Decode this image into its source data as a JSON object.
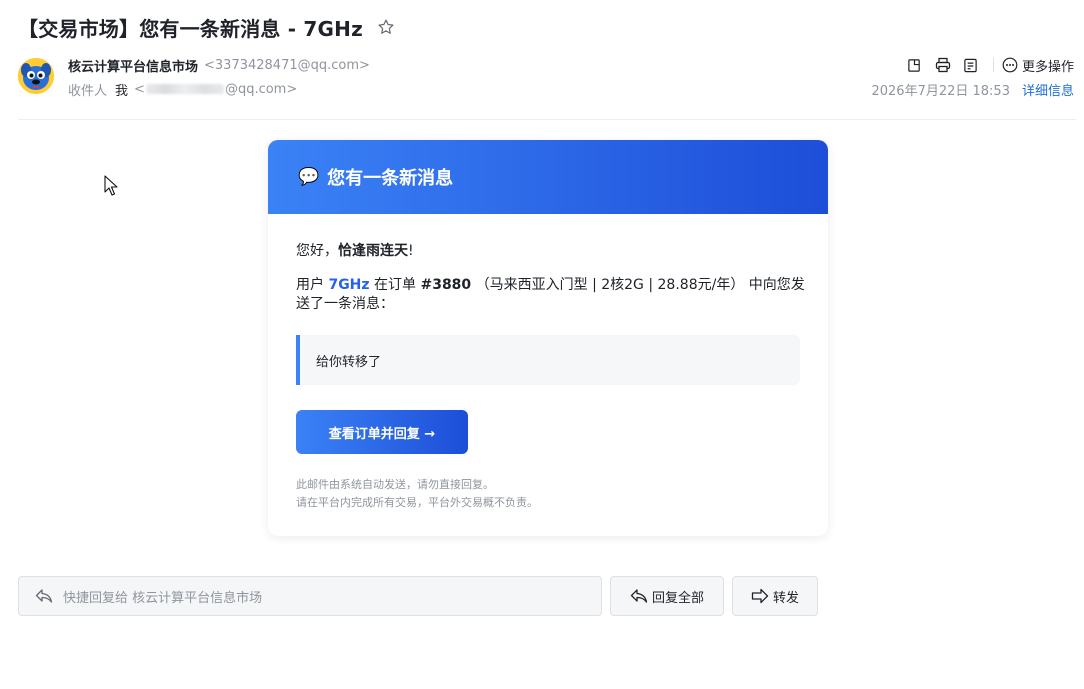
{
  "email": {
    "subject": "【交易市场】您有一条新消息 - 7GHz",
    "sender_name": "核云计算平台信息市场",
    "sender_address": "<3373428471@qq.com>",
    "recipient_label": "收件人",
    "recipient_name": "我",
    "recipient_address_prefix": "<",
    "recipient_address_suffix": "@qq.com>",
    "date": "2026年7月22日 18:53",
    "detail_link": "详细信息",
    "more_ops": "更多操作"
  },
  "card": {
    "emoji": "💬",
    "header": "您有一条新消息",
    "greeting_prefix": "您好，",
    "greeting_name": "恰逢雨连天",
    "greeting_suffix": "!",
    "msg_user_prefix": "用户 ",
    "msg_user": "7GHz",
    "msg_order_prefix": " 在订单 ",
    "msg_order": "#3880",
    "msg_order_detail": " （马来西亚入门型 | 2核2G | 28.88元/年） 中向您发送了一条消息：",
    "quote": "给你转移了",
    "cta": "查看订单并回复 →",
    "footer_line1": "此邮件由系统自动发送，请勿直接回复。",
    "footer_line2": "请在平台内完成所有交易，平台外交易概不负责。"
  },
  "actions": {
    "quick_reply_placeholder": "快捷回复给 核云计算平台信息市场",
    "reply_all": "回复全部",
    "forward": "转发"
  },
  "icons": {
    "star": "star-outline-icon",
    "open_window": "open-in-new-window-icon",
    "print": "printer-icon",
    "note": "note-icon",
    "more": "more-dots-icon",
    "reply": "reply-arrow-icon",
    "forward": "forward-arrow-icon"
  },
  "colors": {
    "accent": "#2563eb",
    "header_gradient_start": "#3b82f6",
    "header_gradient_end": "#1d4ed8",
    "link": "#1d6fd8"
  }
}
